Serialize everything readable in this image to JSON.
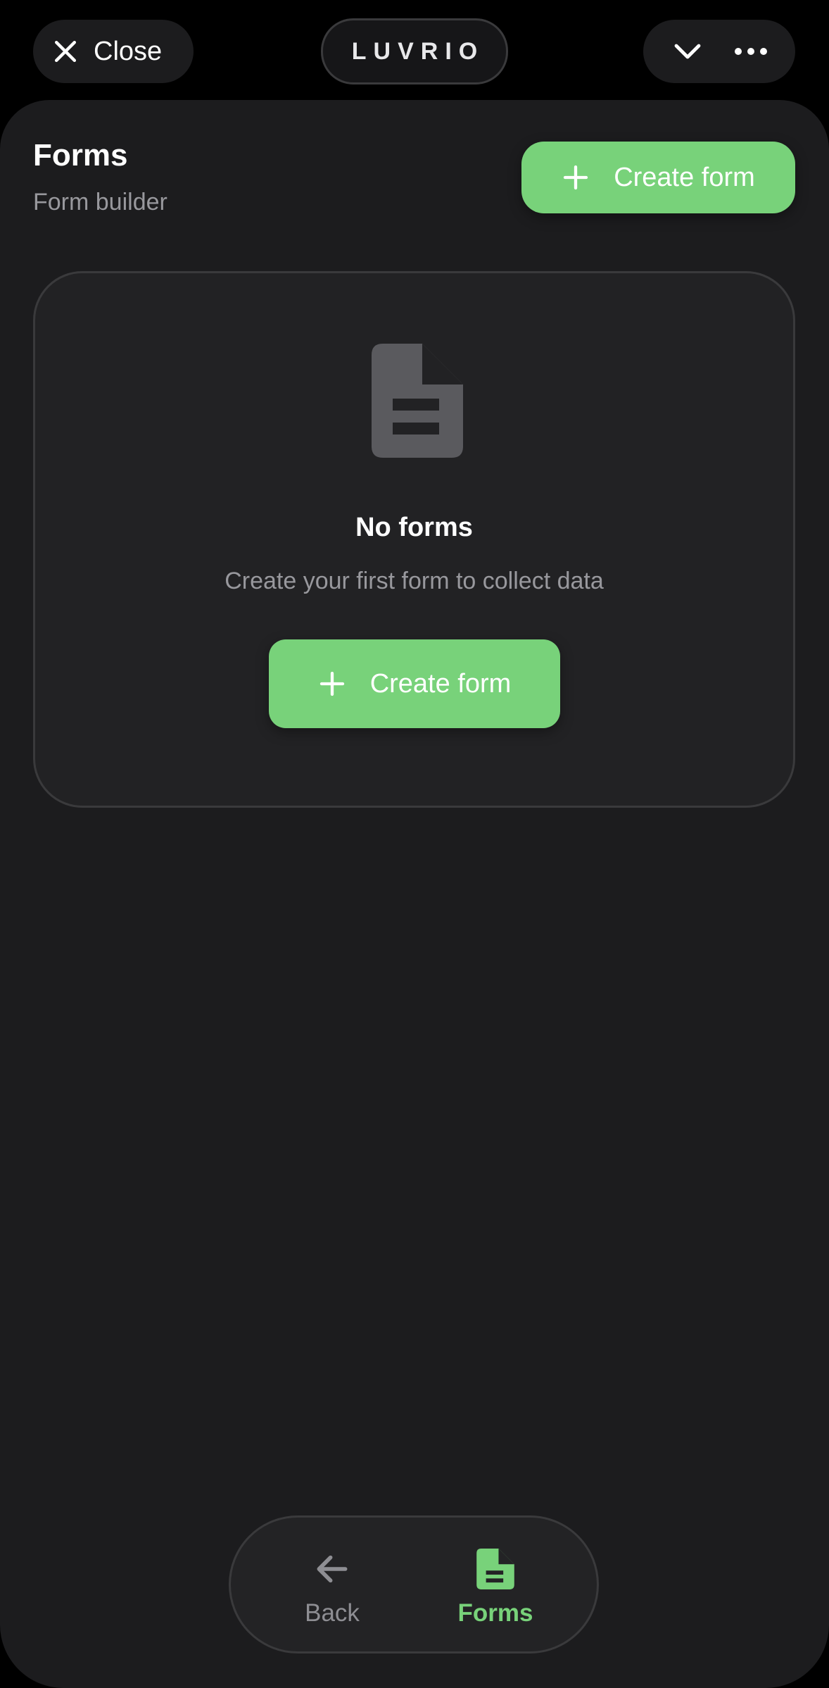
{
  "header": {
    "close_label": "Close",
    "brand": "LUVRIO"
  },
  "page": {
    "title": "Forms",
    "subtitle": "Form builder",
    "create_button_label": "Create form"
  },
  "empty_state": {
    "icon": "document-icon",
    "title": "No forms",
    "message": "Create your first form to collect data",
    "button_label": "Create form"
  },
  "bottom_nav": {
    "items": [
      {
        "label": "Back",
        "icon": "arrow-left-icon",
        "active": false
      },
      {
        "label": "Forms",
        "icon": "document-icon",
        "active": true
      }
    ]
  },
  "colors": {
    "accent": "#78d27a",
    "background": "#000000",
    "surface": "#1c1c1e",
    "muted_text": "#98989d"
  }
}
